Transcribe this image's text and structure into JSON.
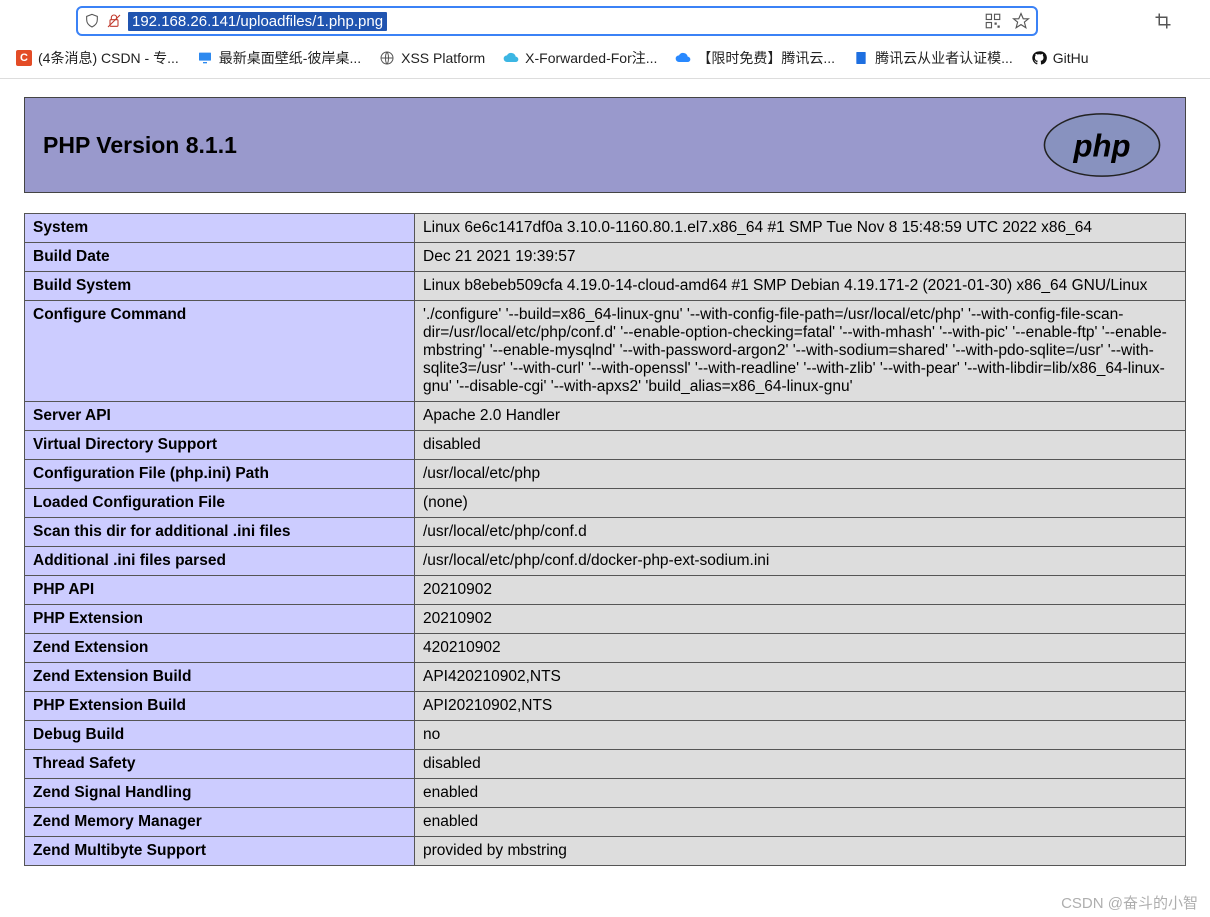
{
  "addrbar": {
    "url": "192.168.26.141/uploadfiles/1.php.png"
  },
  "bookmarks": [
    {
      "icon": "csdn",
      "label": "(4条消息) CSDN - 专..."
    },
    {
      "icon": "wall",
      "label": "最新桌面壁纸-彼岸桌..."
    },
    {
      "icon": "xss",
      "label": "XSS Platform"
    },
    {
      "icon": "xff",
      "label": "X-Forwarded-For注..."
    },
    {
      "icon": "cloud",
      "label": "【限时免费】腾讯云..."
    },
    {
      "icon": "cert",
      "label": "腾讯云从业者认证模..."
    },
    {
      "icon": "gh",
      "label": "GitHu"
    }
  ],
  "php": {
    "title": "PHP Version 8.1.1",
    "rows": [
      {
        "k": "System",
        "v": "Linux 6e6c1417df0a 3.10.0-1160.80.1.el7.x86_64 #1 SMP Tue Nov 8 15:48:59 UTC 2022 x86_64"
      },
      {
        "k": "Build Date",
        "v": "Dec 21 2021 19:39:57"
      },
      {
        "k": "Build System",
        "v": "Linux b8ebeb509cfa 4.19.0-14-cloud-amd64 #1 SMP Debian 4.19.171-2 (2021-01-30) x86_64 GNU/Linux"
      },
      {
        "k": "Configure Command",
        "v": "'./configure' '--build=x86_64-linux-gnu' '--with-config-file-path=/usr/local/etc/php' '--with-config-file-scan-dir=/usr/local/etc/php/conf.d' '--enable-option-checking=fatal' '--with-mhash' '--with-pic' '--enable-ftp' '--enable-mbstring' '--enable-mysqlnd' '--with-password-argon2' '--with-sodium=shared' '--with-pdo-sqlite=/usr' '--with-sqlite3=/usr' '--with-curl' '--with-openssl' '--with-readline' '--with-zlib' '--with-pear' '--with-libdir=lib/x86_64-linux-gnu' '--disable-cgi' '--with-apxs2' 'build_alias=x86_64-linux-gnu'"
      },
      {
        "k": "Server API",
        "v": "Apache 2.0 Handler"
      },
      {
        "k": "Virtual Directory Support",
        "v": "disabled"
      },
      {
        "k": "Configuration File (php.ini) Path",
        "v": "/usr/local/etc/php"
      },
      {
        "k": "Loaded Configuration File",
        "v": "(none)"
      },
      {
        "k": "Scan this dir for additional .ini files",
        "v": "/usr/local/etc/php/conf.d"
      },
      {
        "k": "Additional .ini files parsed",
        "v": "/usr/local/etc/php/conf.d/docker-php-ext-sodium.ini"
      },
      {
        "k": "PHP API",
        "v": "20210902"
      },
      {
        "k": "PHP Extension",
        "v": "20210902"
      },
      {
        "k": "Zend Extension",
        "v": "420210902"
      },
      {
        "k": "Zend Extension Build",
        "v": "API420210902,NTS"
      },
      {
        "k": "PHP Extension Build",
        "v": "API20210902,NTS"
      },
      {
        "k": "Debug Build",
        "v": "no"
      },
      {
        "k": "Thread Safety",
        "v": "disabled"
      },
      {
        "k": "Zend Signal Handling",
        "v": "enabled"
      },
      {
        "k": "Zend Memory Manager",
        "v": "enabled"
      },
      {
        "k": "Zend Multibyte Support",
        "v": "provided by mbstring"
      }
    ]
  },
  "watermark": "CSDN @奋斗的小智"
}
